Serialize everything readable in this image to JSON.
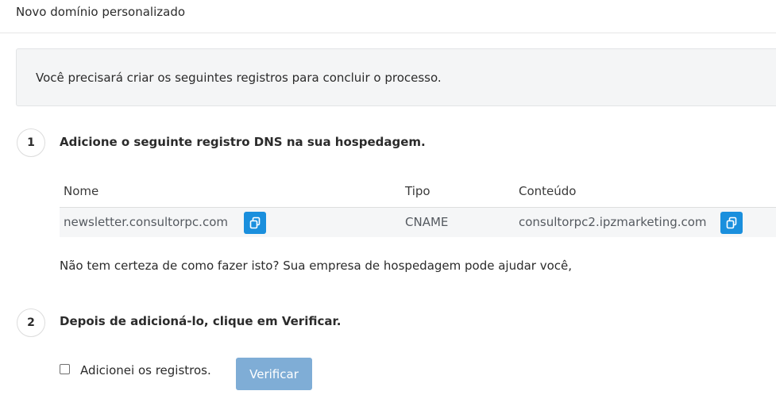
{
  "header": {
    "title": "Novo domínio personalizado"
  },
  "info": {
    "text": "Você precisará criar os seguintes registros para concluir o processo."
  },
  "steps": [
    {
      "number": "1",
      "title": "Adicione o seguinte registro DNS na sua hospedagem."
    },
    {
      "number": "2",
      "title": "Depois de adicioná-lo, clique em Verificar."
    }
  ],
  "dns_table": {
    "headers": [
      "Nome",
      "Tipo",
      "Conteúdo"
    ],
    "row": {
      "name": "newsletter.consultorpc.com",
      "type": "CNAME",
      "content": "consultorpc2.ipzmarketing.com"
    }
  },
  "help": {
    "text": "Não tem certeza de como fazer isto? Sua empresa de hospedagem pode ajudar você,"
  },
  "confirm": {
    "checkbox_label": "Adicionei os registros.",
    "checked": false
  },
  "verify_button": {
    "label": "Verificar"
  },
  "icons": {
    "copy": "copy-icon"
  },
  "colors": {
    "primary": "#1a8fdd",
    "verify_disabled": "#7fadd6"
  }
}
